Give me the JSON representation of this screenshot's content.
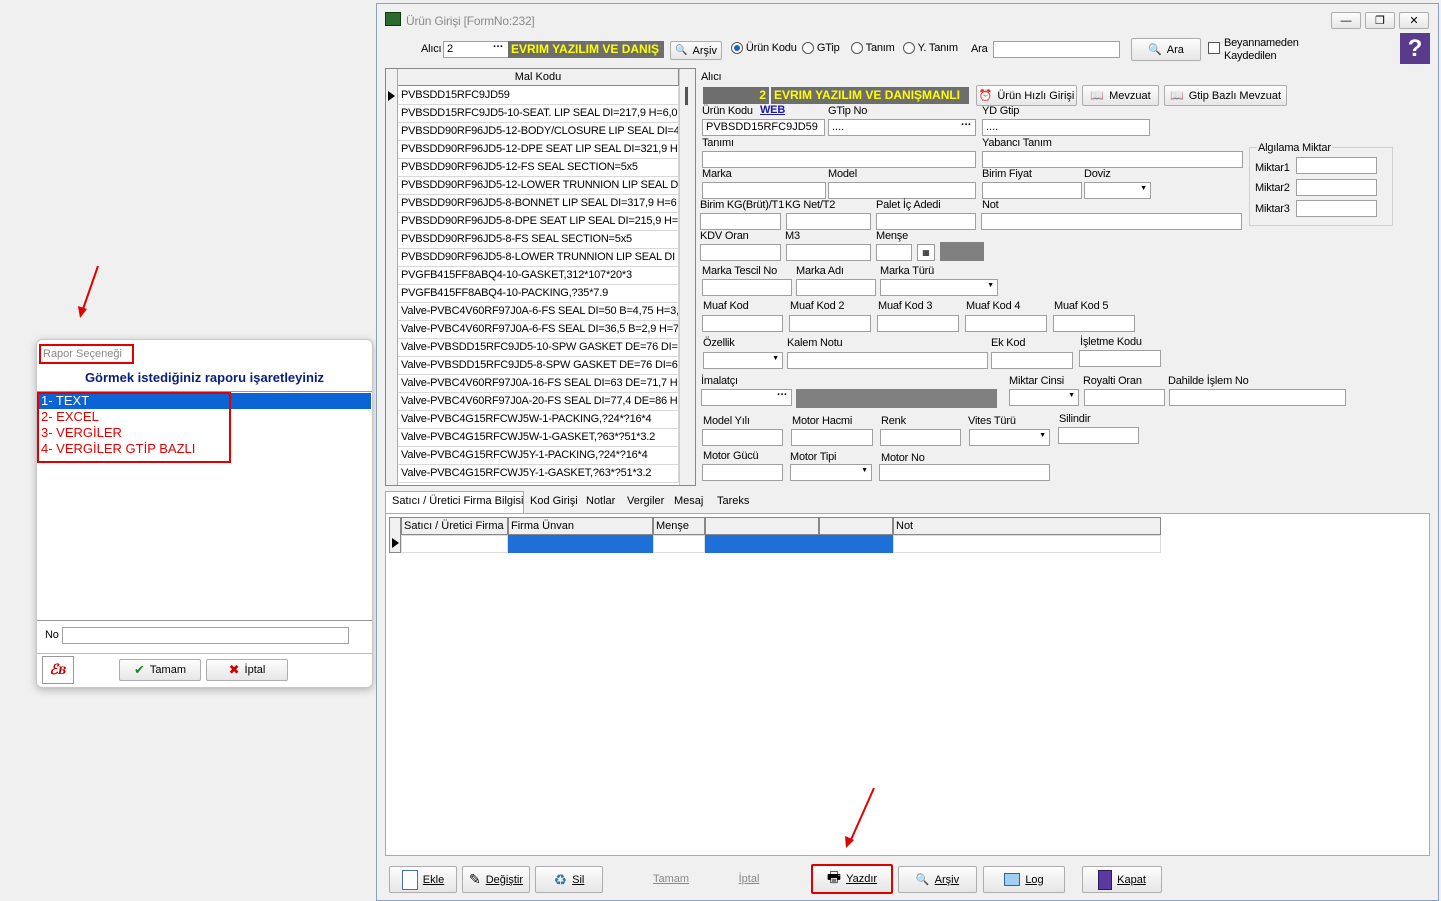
{
  "dialog": {
    "title": "Rapor Seçeneği",
    "heading": "Görmek istediğiniz raporu işaretleyiniz",
    "options": [
      "1- TEXT",
      "2- EXCEL",
      "3- VERGİLER",
      "4- VERGİLER GTİP BAZLI"
    ],
    "selected_index": 0,
    "no_label": "No",
    "no_value": "",
    "ok_label": "Tamam",
    "cancel_label": "İptal"
  },
  "window": {
    "title": "Ürün Girişi [FormNo:232]",
    "toolbar": {
      "alici_label": "Alıcı",
      "alici_value": "2",
      "alici_name": "EVRIM YAZILIM VE DANIŞ",
      "arsiv_label": "Arşiv",
      "radios": [
        "Ürün Kodu",
        "GTip",
        "Tanım",
        "Y. Tanım"
      ],
      "radio_selected": 0,
      "ara_label": "Ara",
      "ara_value": "",
      "ara_button": "Ara",
      "beyan_label_1": "Beyannameden",
      "beyan_label_2": "Kaydedilen"
    },
    "list": {
      "header": "Mal Kodu",
      "rows": [
        "PVBSDD15RFC9JD59",
        "PVBSDD15RFC9JD5-10-SEAT. LIP SEAL DI=217,9 H=6,0",
        "PVBSDD90RF96JD5-12-BODY/CLOSURE LIP SEAL DI=4",
        "PVBSDD90RF96JD5-12-DPE SEAT LIP SEAL DI=321,9 H",
        "PVBSDD90RF96JD5-12-FS SEAL SECTION=5x5",
        "PVBSDD90RF96JD5-12-LOWER TRUNNION LIP SEAL D",
        "PVBSDD90RF96JD5-8-BONNET LIP SEAL DI=317,9 H=6",
        "PVBSDD90RF96JD5-8-DPE SEAT LIP SEAL DI=215,9 H=",
        "PVBSDD90RF96JD5-8-FS SEAL SECTION=5x5",
        "PVBSDD90RF96JD5-8-LOWER TRUNNION LIP SEAL DI",
        "PVGFB415FF8ABQ4-10-GASKET,312*107*20*3",
        "PVGFB415FF8ABQ4-10-PACKING,?35*7.9",
        "Valve-PVBC4V60RF97J0A-6-FS SEAL DI=50 B=4,75 H=3,",
        "Valve-PVBC4V60RF97J0A-6-FS SEAL DI=36,5 B=2,9 H=7",
        "Valve-PVBSDD15RFC9JD5-10-SPW GASKET DE=76 DI=",
        "Valve-PVBSDD15RFC9JD5-8-SPW GASKET DE=76 DI=6",
        "Valve-PVBC4V60RF97J0A-16-FS SEAL DI=63 DE=71,7 H",
        "Valve-PVBC4V60RF97J0A-20-FS SEAL DI=77,4 DE=86 H",
        "Valve-PVBC4G15RFCWJ5W-1-PACKING,?24*?16*4",
        "Valve-PVBC4G15RFCWJ5W-1-GASKET,?63*?51*3.2",
        "Valve-PVBC4G15RFCWJ5Y-1-PACKING,?24*?16*4",
        "Valve-PVBC4G15RFCWJ5Y-1-GASKET,?63*?51*3.2"
      ]
    },
    "form": {
      "alici_label": "Alıcı",
      "alici_no": "2",
      "alici_name": "EVRIM YAZILIM VE DANIŞMANLI",
      "hizli_button": "Ürün Hızlı Girişi",
      "mevzuat_button": "Mevzuat",
      "gtip_mevzuat_button": "Gtip Bazlı Mevzuat",
      "urun_kodu_label": "Ürün Kodu",
      "web_label": "WEB",
      "urun_kodu_value": "PVBSDD15RFC9JD59",
      "gtip_label": "GTip No",
      "gtip_value": "....",
      "yd_gtip_label": "YD Gtip",
      "yd_gtip_value": "....",
      "tanimi_label": "Tanımı",
      "yabanci_label": "Yabancı Tanım",
      "algilama_title": "Algılama Miktar",
      "miktar1": "Miktar1",
      "miktar2": "Miktar2",
      "miktar3": "Miktar3",
      "marka_label": "Marka",
      "model_label": "Model",
      "birim_fiyat_label": "Birim Fiyat",
      "doviz_label": "Doviz",
      "birim_kg_label": "Birim KG(Brüt)/T1",
      "kg_net_label": "KG Net/T2",
      "palet_label": "Palet İç Adedi",
      "not_label": "Not",
      "kdv_label": "KDV Oran",
      "m3_label": "M3",
      "mense_label": "Menşe",
      "marka_tescil_label": "Marka Tescil No",
      "marka_adi_label": "Marka Adı",
      "marka_turu_label": "Marka Türü",
      "muaf1": "Muaf Kod",
      "muaf2": "Muaf Kod 2",
      "muaf3": "Muaf Kod 3",
      "muaf4": "Muaf Kod 4",
      "muaf5": "Muaf Kod 5",
      "ozellik_label": "Özellik",
      "kalem_notu_label": "Kalem Notu",
      "ek_kod_label": "Ek Kod",
      "isletme_label": "İşletme Kodu",
      "imalatci_label": "İmalatçı",
      "miktar_cinsi_label": "Miktar Cinsi",
      "royalti_label": "Royalti Oran",
      "dahilde_label": "Dahilde İşlem No",
      "model_yili_label": "Model Yılı",
      "motor_hacmi_label": "Motor Hacmi",
      "renk_label": "Renk",
      "vites_label": "Vites Türü",
      "silindir_label": "Silindir",
      "motor_gucu_label": "Motor Gücü",
      "motor_tipi_label": "Motor Tipi",
      "motor_no_label": "Motor No"
    },
    "tabs": [
      "Satıcı / Üretici Firma Bilgisi",
      "Kod Girişi",
      "Notlar",
      "Vergiler",
      "Mesaj",
      "Tareks"
    ],
    "grid_headers": [
      "Satıcı / Üretici Firma",
      "Firma Ünvan",
      "Menşe",
      "",
      "",
      "Not"
    ],
    "bottom_buttons": {
      "ekle": "Ekle",
      "degistir": "Değiştir",
      "sil": "Sil",
      "tamam": "Tamam",
      "iptal": "İptal",
      "yazdir": "Yazdır",
      "arsiv": "Arşiv",
      "log": "Log",
      "kapat": "Kapat"
    }
  },
  "colors": {
    "highlight_red": "#e00000",
    "selection_blue": "#0a64d6",
    "yellow_text": "#ffff00",
    "dark_label_bg": "#6e6e6e"
  }
}
